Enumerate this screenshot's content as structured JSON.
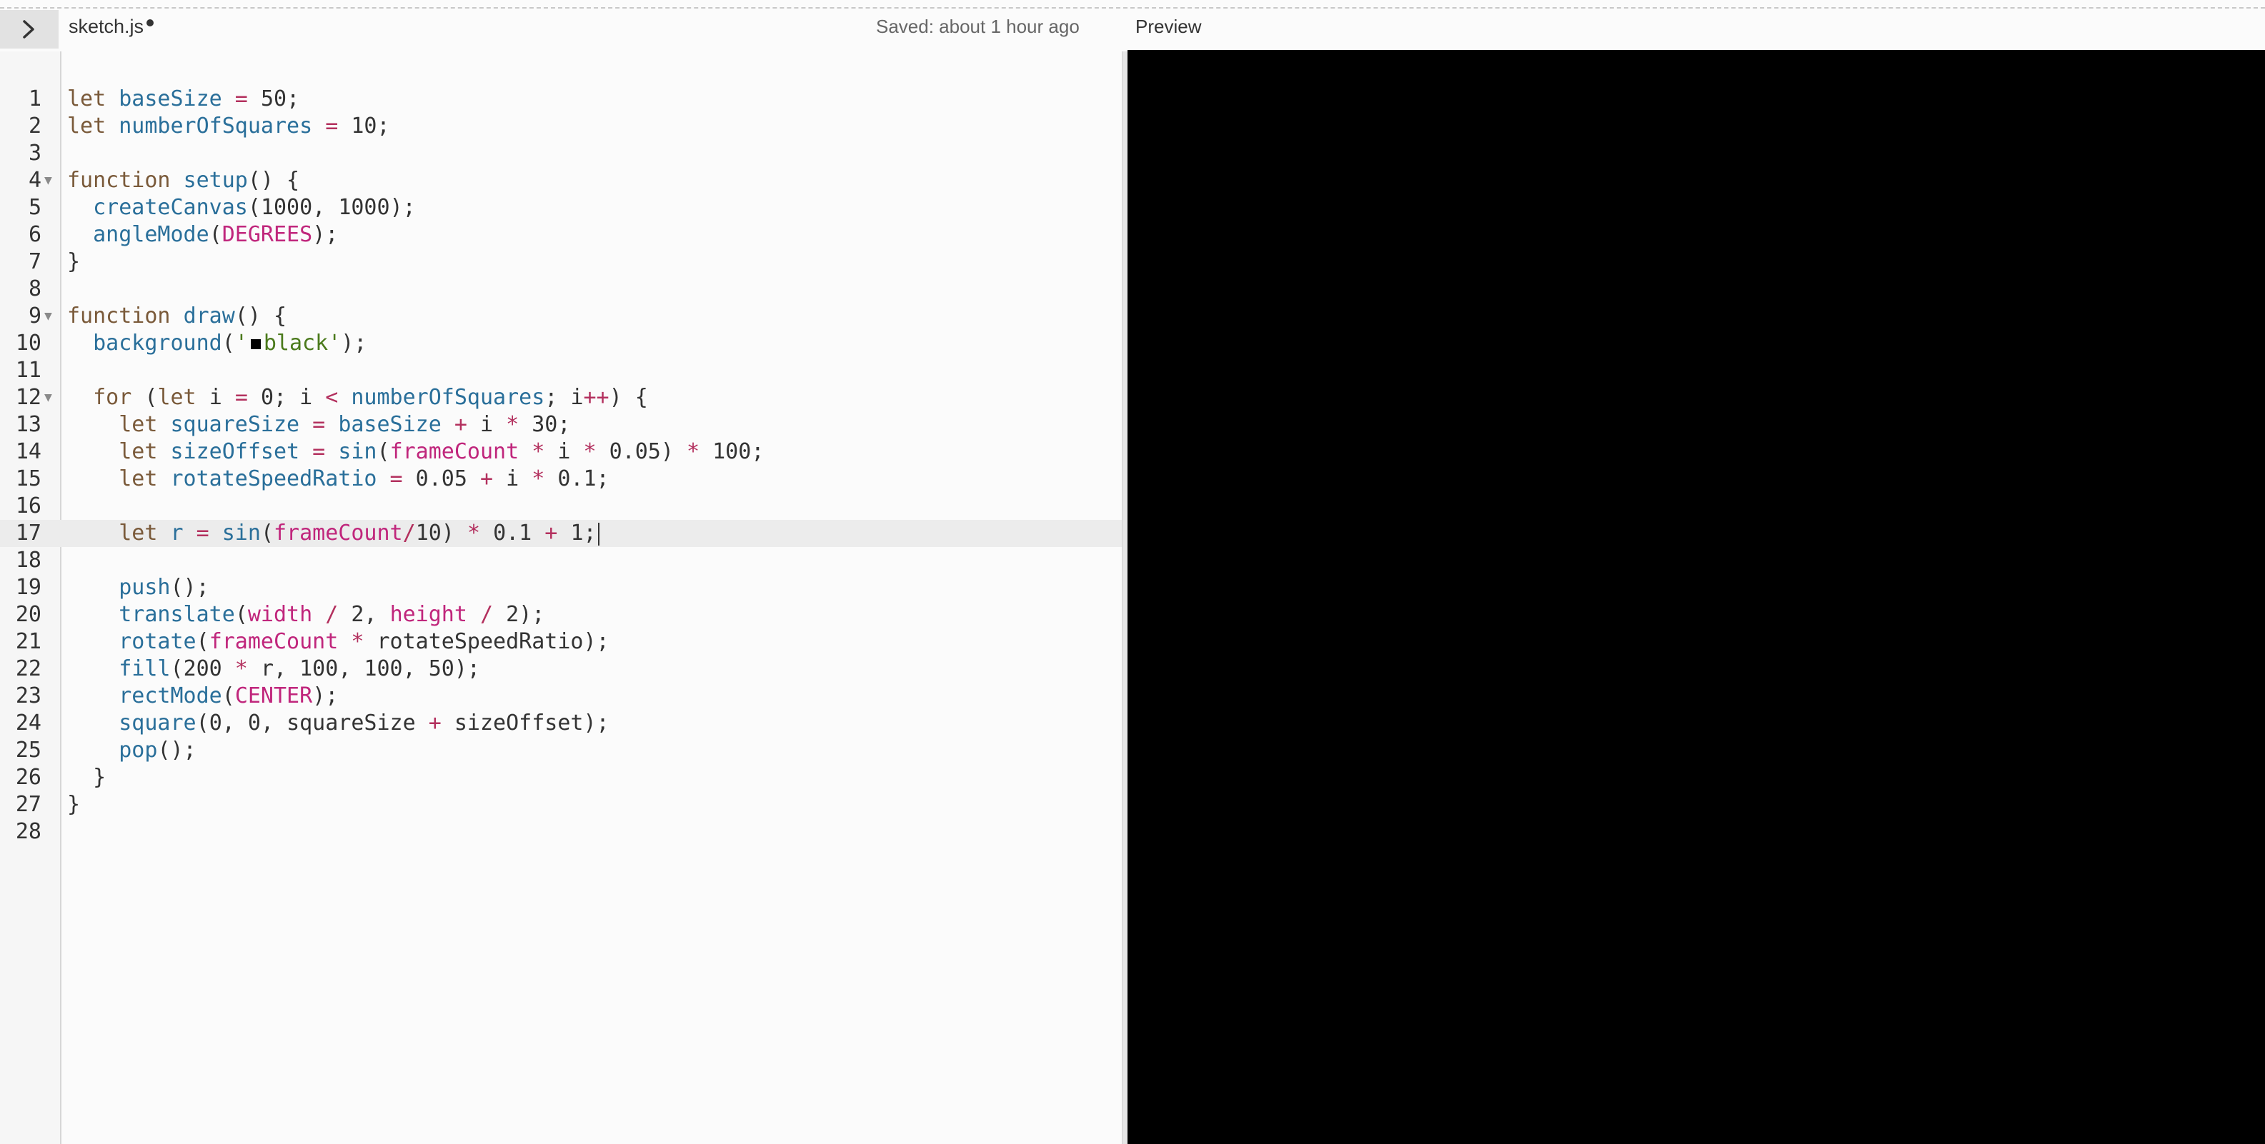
{
  "header": {
    "toggle_icon": "chevron-right-icon",
    "file_name": "sketch.js",
    "unsaved_indicator": true,
    "save_status": "Saved: about 1 hour ago",
    "preview_label": "Preview"
  },
  "editor": {
    "active_line": 17,
    "fold_lines": [
      4,
      9,
      12
    ],
    "lines": [
      [
        [
          "kw",
          "let "
        ],
        [
          "id",
          "baseSize"
        ],
        [
          "op",
          " = "
        ],
        [
          "num",
          "50"
        ],
        [
          "pun",
          ";"
        ]
      ],
      [
        [
          "kw",
          "let "
        ],
        [
          "id",
          "numberOfSquares"
        ],
        [
          "op",
          " = "
        ],
        [
          "num",
          "10"
        ],
        [
          "pun",
          ";"
        ]
      ],
      [],
      [
        [
          "kw",
          "function "
        ],
        [
          "fn",
          "setup"
        ],
        [
          "pun",
          "() {"
        ]
      ],
      [
        [
          "plain",
          "  "
        ],
        [
          "fn",
          "createCanvas"
        ],
        [
          "pun",
          "("
        ],
        [
          "num",
          "1000"
        ],
        [
          "pun",
          ", "
        ],
        [
          "num",
          "1000"
        ],
        [
          "pun",
          ");"
        ]
      ],
      [
        [
          "plain",
          "  "
        ],
        [
          "fn",
          "angleMode"
        ],
        [
          "pun",
          "("
        ],
        [
          "const",
          "DEGREES"
        ],
        [
          "pun",
          ");"
        ]
      ],
      [
        [
          "pun",
          "}"
        ]
      ],
      [],
      [
        [
          "kw",
          "function "
        ],
        [
          "fn",
          "draw"
        ],
        [
          "pun",
          "() {"
        ]
      ],
      [
        [
          "plain",
          "  "
        ],
        [
          "fn",
          "background"
        ],
        [
          "pun",
          "("
        ],
        [
          "str",
          "'"
        ],
        [
          "swatch",
          ""
        ],
        [
          "str",
          "black'"
        ],
        [
          "pun",
          ");"
        ]
      ],
      [],
      [
        [
          "plain",
          "  "
        ],
        [
          "kw",
          "for "
        ],
        [
          "pun",
          "("
        ],
        [
          "kw",
          "let "
        ],
        [
          "plain",
          "i "
        ],
        [
          "op",
          "="
        ],
        [
          "plain",
          " "
        ],
        [
          "num",
          "0"
        ],
        [
          "pun",
          "; "
        ],
        [
          "plain",
          "i "
        ],
        [
          "op",
          "<"
        ],
        [
          "plain",
          " "
        ],
        [
          "id",
          "numberOfSquares"
        ],
        [
          "pun",
          "; "
        ],
        [
          "plain",
          "i"
        ],
        [
          "op",
          "++"
        ],
        [
          "pun",
          ") {"
        ]
      ],
      [
        [
          "plain",
          "    "
        ],
        [
          "kw",
          "let "
        ],
        [
          "id",
          "squareSize"
        ],
        [
          "op",
          " = "
        ],
        [
          "id",
          "baseSize"
        ],
        [
          "op",
          " + "
        ],
        [
          "plain",
          "i "
        ],
        [
          "op",
          "*"
        ],
        [
          "plain",
          " "
        ],
        [
          "num",
          "30"
        ],
        [
          "pun",
          ";"
        ]
      ],
      [
        [
          "plain",
          "    "
        ],
        [
          "kw",
          "let "
        ],
        [
          "id",
          "sizeOffset"
        ],
        [
          "op",
          " = "
        ],
        [
          "fn",
          "sin"
        ],
        [
          "pun",
          "("
        ],
        [
          "const",
          "frameCount"
        ],
        [
          "op",
          " * "
        ],
        [
          "plain",
          "i "
        ],
        [
          "op",
          "*"
        ],
        [
          "plain",
          " "
        ],
        [
          "num",
          "0.05"
        ],
        [
          "pun",
          ") "
        ],
        [
          "op",
          "*"
        ],
        [
          "plain",
          " "
        ],
        [
          "num",
          "100"
        ],
        [
          "pun",
          ";"
        ]
      ],
      [
        [
          "plain",
          "    "
        ],
        [
          "kw",
          "let "
        ],
        [
          "id",
          "rotateSpeedRatio"
        ],
        [
          "op",
          " = "
        ],
        [
          "num",
          "0.05"
        ],
        [
          "op",
          " + "
        ],
        [
          "plain",
          "i "
        ],
        [
          "op",
          "*"
        ],
        [
          "plain",
          " "
        ],
        [
          "num",
          "0.1"
        ],
        [
          "pun",
          ";"
        ]
      ],
      [],
      [
        [
          "plain",
          "    "
        ],
        [
          "kw",
          "let "
        ],
        [
          "id",
          "r"
        ],
        [
          "op",
          " = "
        ],
        [
          "fn",
          "sin"
        ],
        [
          "pun",
          "("
        ],
        [
          "const",
          "frameCount"
        ],
        [
          "op",
          "/"
        ],
        [
          "num",
          "10"
        ],
        [
          "pun",
          ") "
        ],
        [
          "op",
          "*"
        ],
        [
          "plain",
          " "
        ],
        [
          "num",
          "0.1"
        ],
        [
          "op",
          " + "
        ],
        [
          "num",
          "1"
        ],
        [
          "pun",
          ";"
        ]
      ],
      [],
      [
        [
          "plain",
          "    "
        ],
        [
          "fn",
          "push"
        ],
        [
          "pun",
          "();"
        ]
      ],
      [
        [
          "plain",
          "    "
        ],
        [
          "fn",
          "translate"
        ],
        [
          "pun",
          "("
        ],
        [
          "const",
          "width"
        ],
        [
          "op",
          " / "
        ],
        [
          "num",
          "2"
        ],
        [
          "pun",
          ", "
        ],
        [
          "const",
          "height"
        ],
        [
          "op",
          " / "
        ],
        [
          "num",
          "2"
        ],
        [
          "pun",
          ");"
        ]
      ],
      [
        [
          "plain",
          "    "
        ],
        [
          "fn",
          "rotate"
        ],
        [
          "pun",
          "("
        ],
        [
          "const",
          "frameCount"
        ],
        [
          "op",
          " * "
        ],
        [
          "plain",
          "rotateSpeedRatio"
        ],
        [
          "pun",
          ");"
        ]
      ],
      [
        [
          "plain",
          "    "
        ],
        [
          "fn",
          "fill"
        ],
        [
          "pun",
          "("
        ],
        [
          "num",
          "200"
        ],
        [
          "op",
          " * "
        ],
        [
          "plain",
          "r"
        ],
        [
          "pun",
          ", "
        ],
        [
          "num",
          "100"
        ],
        [
          "pun",
          ", "
        ],
        [
          "num",
          "100"
        ],
        [
          "pun",
          ", "
        ],
        [
          "num",
          "50"
        ],
        [
          "pun",
          ");"
        ]
      ],
      [
        [
          "plain",
          "    "
        ],
        [
          "fn",
          "rectMode"
        ],
        [
          "pun",
          "("
        ],
        [
          "const",
          "CENTER"
        ],
        [
          "pun",
          ");"
        ]
      ],
      [
        [
          "plain",
          "    "
        ],
        [
          "fn",
          "square"
        ],
        [
          "pun",
          "("
        ],
        [
          "num",
          "0"
        ],
        [
          "pun",
          ", "
        ],
        [
          "num",
          "0"
        ],
        [
          "pun",
          ", "
        ],
        [
          "plain",
          "squareSize "
        ],
        [
          "op",
          "+"
        ],
        [
          "plain",
          " sizeOffset"
        ],
        [
          "pun",
          ");"
        ]
      ],
      [
        [
          "plain",
          "    "
        ],
        [
          "fn",
          "pop"
        ],
        [
          "pun",
          "();"
        ]
      ],
      [
        [
          "plain",
          "  "
        ],
        [
          "pun",
          "}"
        ]
      ],
      [
        [
          "pun",
          "}"
        ]
      ],
      []
    ]
  },
  "preview": {
    "background": "#000000",
    "fill_color": "#c86464",
    "fill_opacity": 0.196
  }
}
